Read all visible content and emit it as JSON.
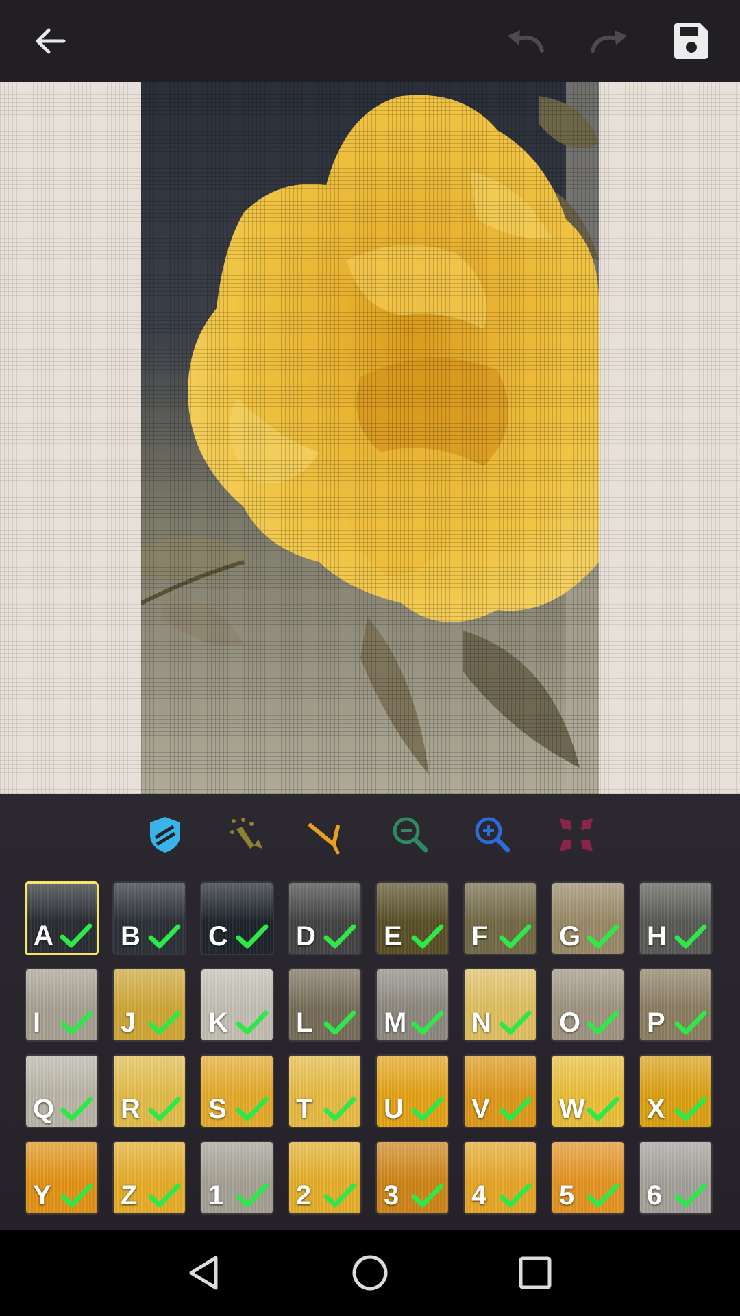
{
  "toolbar_top": {
    "back_icon": "arrow-left-icon",
    "undo_icon": "undo-icon",
    "redo_icon": "redo-icon",
    "save_icon": "floppy-save-icon",
    "bar_color": "#221f24"
  },
  "tools": [
    {
      "name": "shield-tool",
      "icon": "shield-icon",
      "color": "#3ab4e8"
    },
    {
      "name": "magic-wand-tool",
      "icon": "sparkle-wand-icon",
      "color": "#8c8232"
    },
    {
      "name": "needle-tool",
      "icon": "needle-icon",
      "color": "#e8a020"
    },
    {
      "name": "zoom-out-tool",
      "icon": "zoom-out-icon",
      "color": "#2f8a64"
    },
    {
      "name": "zoom-in-tool",
      "icon": "zoom-in-icon",
      "color": "#2f6bd8"
    },
    {
      "name": "fit-screen-tool",
      "icon": "compress-arrows-icon",
      "color": "#8a2448"
    }
  ],
  "palette": [
    {
      "label": "A",
      "color": "#2a2d33",
      "selected": true
    },
    {
      "label": "B",
      "color": "#2c3038",
      "selected": false
    },
    {
      "label": "C",
      "color": "#1f242c",
      "selected": false
    },
    {
      "label": "D",
      "color": "#444444",
      "selected": false
    },
    {
      "label": "E",
      "color": "#5a5028",
      "selected": false
    },
    {
      "label": "F",
      "color": "#746a48",
      "selected": false
    },
    {
      "label": "G",
      "color": "#9a8a68",
      "selected": false
    },
    {
      "label": "H",
      "color": "#5a5a56",
      "selected": false
    },
    {
      "label": "I",
      "color": "#a8a294",
      "selected": false
    },
    {
      "label": "J",
      "color": "#d0a838",
      "selected": false
    },
    {
      "label": "K",
      "color": "#c4c0b4",
      "selected": false
    },
    {
      "label": "L",
      "color": "#786e5a",
      "selected": false
    },
    {
      "label": "M",
      "color": "#8e8a82",
      "selected": false
    },
    {
      "label": "N",
      "color": "#e0c062",
      "selected": false
    },
    {
      "label": "O",
      "color": "#a09682",
      "selected": false
    },
    {
      "label": "P",
      "color": "#8c7e62",
      "selected": false
    },
    {
      "label": "Q",
      "color": "#bab6a8",
      "selected": false
    },
    {
      "label": "R",
      "color": "#e4be4c",
      "selected": false
    },
    {
      "label": "S",
      "color": "#e6ac2c",
      "selected": false
    },
    {
      "label": "T",
      "color": "#e8bc44",
      "selected": false
    },
    {
      "label": "U",
      "color": "#e6a418",
      "selected": false
    },
    {
      "label": "V",
      "color": "#e09a1c",
      "selected": false
    },
    {
      "label": "W",
      "color": "#ecc03a",
      "selected": false
    },
    {
      "label": "X",
      "color": "#dca214",
      "selected": false
    },
    {
      "label": "Y",
      "color": "#e29416",
      "selected": false
    },
    {
      "label": "Z",
      "color": "#e8ae2a",
      "selected": false
    },
    {
      "label": "1",
      "color": "#a6a296",
      "selected": false
    },
    {
      "label": "2",
      "color": "#e6b02c",
      "selected": false
    },
    {
      "label": "3",
      "color": "#d0861a",
      "selected": false
    },
    {
      "label": "4",
      "color": "#e8a82a",
      "selected": false
    },
    {
      "label": "5",
      "color": "#e69624",
      "selected": false
    },
    {
      "label": "6",
      "color": "#a4a29a",
      "selected": false
    }
  ],
  "nav": {
    "back_icon": "nav-back-triangle-icon",
    "home_icon": "nav-home-circle-icon",
    "recents_icon": "nav-recents-square-icon"
  }
}
